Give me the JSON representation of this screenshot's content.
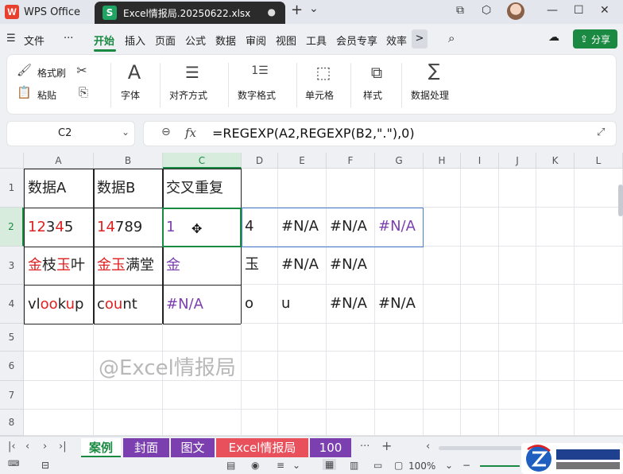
{
  "titlebar": {
    "app_tab": "WPS Office",
    "app_logo": "W",
    "file_logo": "S",
    "file_tab": "Excel情报局.20250622.xlsx",
    "modified_dot": "●",
    "new_tab": "+",
    "dropdown": "⌄",
    "minimize": "—",
    "maximize": "☐",
    "close": "✕"
  },
  "menu": {
    "file": "文件",
    "more": "···",
    "items": [
      "开始",
      "插入",
      "页面",
      "公式",
      "数据",
      "审阅",
      "视图",
      "工具",
      "会员专享",
      "效率"
    ],
    "more_arrow": ">",
    "share": "分享"
  },
  "ribbon": {
    "format_painter": "格式刷",
    "paste": "粘贴",
    "font": "字体",
    "align": "对齐方式",
    "number_format": "数字格式",
    "cell": "单元格",
    "style": "样式",
    "data_process": "数据处理",
    "icon_font": "A",
    "icon_align": "☰",
    "icon_number": "1☰",
    "icon_cell": "⬚",
    "icon_style": "⧉",
    "icon_sum": "∑"
  },
  "formula_bar": {
    "cell_ref": "C2",
    "fx": "fx",
    "formula": "=REGEXP(A2,REGEXP(B2,\".\"),0)"
  },
  "grid": {
    "columns": [
      "A",
      "B",
      "C",
      "D",
      "E",
      "F",
      "G",
      "H",
      "I",
      "J",
      "K",
      "L"
    ],
    "rows": [
      "1",
      "2",
      "3",
      "4",
      "5",
      "6",
      "7",
      "8"
    ],
    "cells": {
      "A1": "数据A",
      "B1": "数据B",
      "C1": "交叉重复",
      "C2": "1",
      "D2": "4",
      "E2": "#N/A",
      "F2": "#N/A",
      "G2": "#N/A",
      "C3": "金",
      "D3": "玉",
      "E3": "#N/A",
      "F3": "#N/A",
      "C4": "#N/A",
      "D4": "o",
      "E4": "u",
      "F4": "#N/A",
      "G4": "#N/A"
    },
    "A2": [
      "1",
      "2",
      "3",
      "4",
      "5"
    ],
    "B2": [
      "1",
      "4",
      "789"
    ],
    "A3": [
      "金",
      "枝",
      "玉",
      "叶"
    ],
    "B3": [
      "金",
      "玉",
      "满堂"
    ],
    "A4": [
      "v",
      "l",
      "oo",
      "k",
      "u",
      "p"
    ],
    "B4": [
      "c",
      "ou",
      "nt"
    ],
    "watermark": "@Excel情报局"
  },
  "sheets": {
    "tabs": [
      "案例",
      "封面",
      "图文",
      "Excel情报局",
      "100"
    ],
    "more": "···",
    "add": "+"
  },
  "status": {
    "zoom": "100%"
  },
  "colors": {
    "accent": "#1a8a42",
    "red_text": "#e02020",
    "purple_text": "#7b3fb0",
    "tab_purple": "#7b3fb0",
    "tab_red": "#e8505b"
  }
}
